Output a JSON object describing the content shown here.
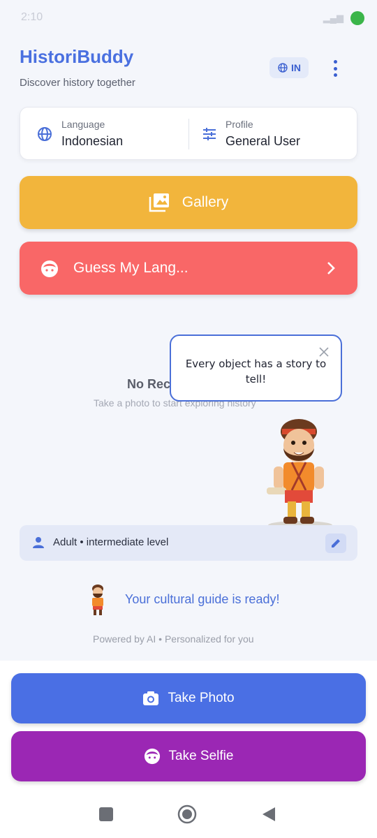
{
  "status_bar": {
    "time": "2:10",
    "indicator_color": "#3bb54a"
  },
  "header": {
    "title": "HistoriBuddy",
    "subtitle": "Discover history together",
    "language_badge": "IN",
    "menu_icon": "more-vert-icon"
  },
  "info_card": {
    "language_label": "Language",
    "language_value": "Indonesian",
    "language_icon": "globe-icon",
    "profile_label": "Profile",
    "profile_value": "General User",
    "profile_icon": "tune-icon"
  },
  "buttons": {
    "gallery_label": "Gallery",
    "gallery_icon": "gallery-icon",
    "gallery_color": "#f2b53c",
    "guess_label": "Guess My Lang...",
    "guess_icon": "face-icon",
    "guess_color": "#f96767"
  },
  "empty_state": {
    "title": "No Rec",
    "subtitle": "Take a photo to start exploring history"
  },
  "speech_bubble": {
    "text": "Every object has a story to tell!"
  },
  "level_bar": {
    "text": "Adult • intermediate level",
    "icon": "person-icon",
    "edit_icon": "edit-icon"
  },
  "guide": {
    "ready_text": "Your cultural guide is ready!",
    "powered_text": "Powered by AI • Personalized for you"
  },
  "actions": {
    "take_photo_label": "Take Photo",
    "take_photo_color": "#4a6fe4",
    "take_selfie_label": "Take Selfie",
    "take_selfie_color": "#9b27b4"
  },
  "accent_color": "#4a70e0"
}
